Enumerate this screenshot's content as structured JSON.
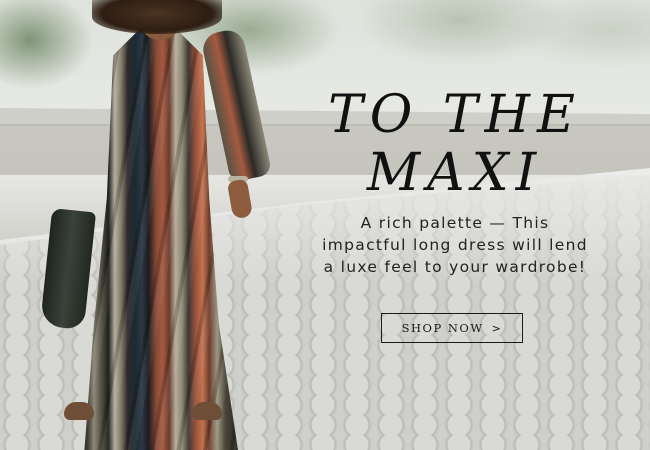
{
  "hero": {
    "headline": "TO THE MAXI",
    "subtext": "A rich palette — This impactful long dress will lend a luxe feel to your wardrobe!",
    "cta_label": "SHOP NOW",
    "cta_arrow": ">"
  },
  "colors": {
    "text": "#111111",
    "background": "#e6e8e3",
    "dress_rust": "#a45a40",
    "dress_charcoal": "#2a2a26"
  }
}
